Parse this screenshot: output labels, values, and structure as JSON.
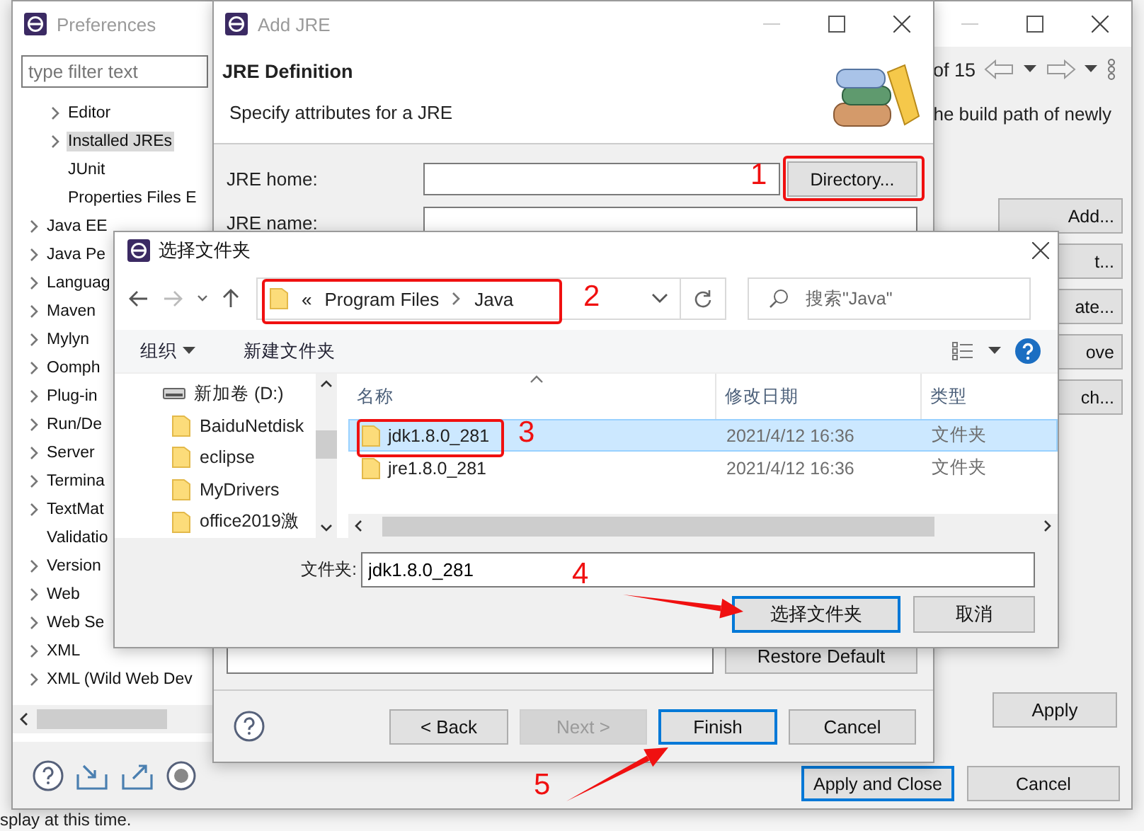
{
  "ide_background": {
    "status_text": "splay at this time."
  },
  "preferences": {
    "title": "Preferences",
    "filter": {
      "placeholder": "type filter text"
    },
    "tree": [
      {
        "children": [
          {
            "label": "Editor",
            "has_children": true,
            "selected": false
          },
          {
            "label": "Installed JREs",
            "has_children": true,
            "selected": true
          },
          {
            "label": "JUnit",
            "has_children": false,
            "selected": false
          },
          {
            "label": "Properties Files E",
            "has_children": false,
            "selected": false
          }
        ]
      },
      {
        "label": "Java EE",
        "has_children": true,
        "selected": false
      },
      {
        "label": "Java Pe",
        "has_children": true,
        "selected": false
      },
      {
        "label": "Languag",
        "has_children": true,
        "selected": false
      },
      {
        "label": "Maven",
        "has_children": true,
        "selected": false
      },
      {
        "label": "Mylyn",
        "has_children": true,
        "selected": false
      },
      {
        "label": "Oomph",
        "has_children": true,
        "selected": false
      },
      {
        "label": "Plug-in",
        "has_children": true,
        "selected": false
      },
      {
        "label": "Run/De",
        "has_children": true,
        "selected": false
      },
      {
        "label": "Server",
        "has_children": true,
        "selected": false
      },
      {
        "label": "Termina",
        "has_children": true,
        "selected": false
      },
      {
        "label": "TextMat",
        "has_children": true,
        "selected": false
      },
      {
        "label": "Validatio",
        "has_children": false,
        "selected": false
      },
      {
        "label": "Version",
        "has_children": true,
        "selected": false
      },
      {
        "label": "Web",
        "has_children": true,
        "selected": false
      },
      {
        "label": "Web Se",
        "has_children": true,
        "selected": false
      },
      {
        "label": "XML",
        "has_children": true,
        "selected": false
      },
      {
        "label": "XML (Wild Web Dev",
        "has_children": true,
        "selected": false
      }
    ],
    "page_counter": "of 15",
    "description": "he build path of newly",
    "side_buttons": [
      "Add...",
      "t...",
      "ate...",
      "ove",
      "ch..."
    ],
    "apply_button": "Apply",
    "footer_buttons": [
      {
        "label": "Apply and Close",
        "default": true
      },
      {
        "label": "Cancel",
        "default": false
      }
    ]
  },
  "add_jre": {
    "title": "Add JRE",
    "heading": "JRE Definition",
    "subtitle": "Specify attributes for a JRE",
    "fields": [
      {
        "label": "JRE home:",
        "button": "Directory..."
      },
      {
        "label": "JRE name:"
      }
    ],
    "restore_button": "Restore Default",
    "buttons": [
      {
        "label": "< Back",
        "default": false,
        "disabled": false
      },
      {
        "label": "Next >",
        "default": false,
        "disabled": true
      },
      {
        "label": "Finish",
        "default": true,
        "disabled": false
      },
      {
        "label": "Cancel",
        "default": false,
        "disabled": false
      }
    ]
  },
  "folder_dialog": {
    "title": "选择文件夹",
    "breadcrumb_overflow": "«",
    "breadcrumb": [
      "Program Files",
      "Java"
    ],
    "search": {
      "placeholder": "搜索\"Java\""
    },
    "organize": "组织",
    "new_folder": "新建文件夹",
    "drive": "新加卷 (D:)",
    "nav_folders": [
      "BaiduNetdisk",
      "eclipse",
      "MyDrivers",
      "office2019激"
    ],
    "columns": [
      "名称",
      "修改日期",
      "类型"
    ],
    "rows": [
      {
        "name": "jdk1.8.0_281",
        "date": "2021/4/12 16:36",
        "type": "文件夹",
        "selected": true
      },
      {
        "name": "jre1.8.0_281",
        "date": "2021/4/12 16:36",
        "type": "文件夹",
        "selected": false
      }
    ],
    "folder_label": "文件夹:",
    "folder_value": "jdk1.8.0_281",
    "buttons": [
      {
        "label": "选择文件夹",
        "default": true
      },
      {
        "label": "取消",
        "default": false
      }
    ]
  },
  "annotations": [
    {
      "number": "1",
      "kind": "frame"
    },
    {
      "number": "2",
      "kind": "frame"
    },
    {
      "number": "3",
      "kind": "frame"
    },
    {
      "number": "4",
      "kind": "arrow"
    },
    {
      "number": "5",
      "kind": "arrow"
    }
  ]
}
